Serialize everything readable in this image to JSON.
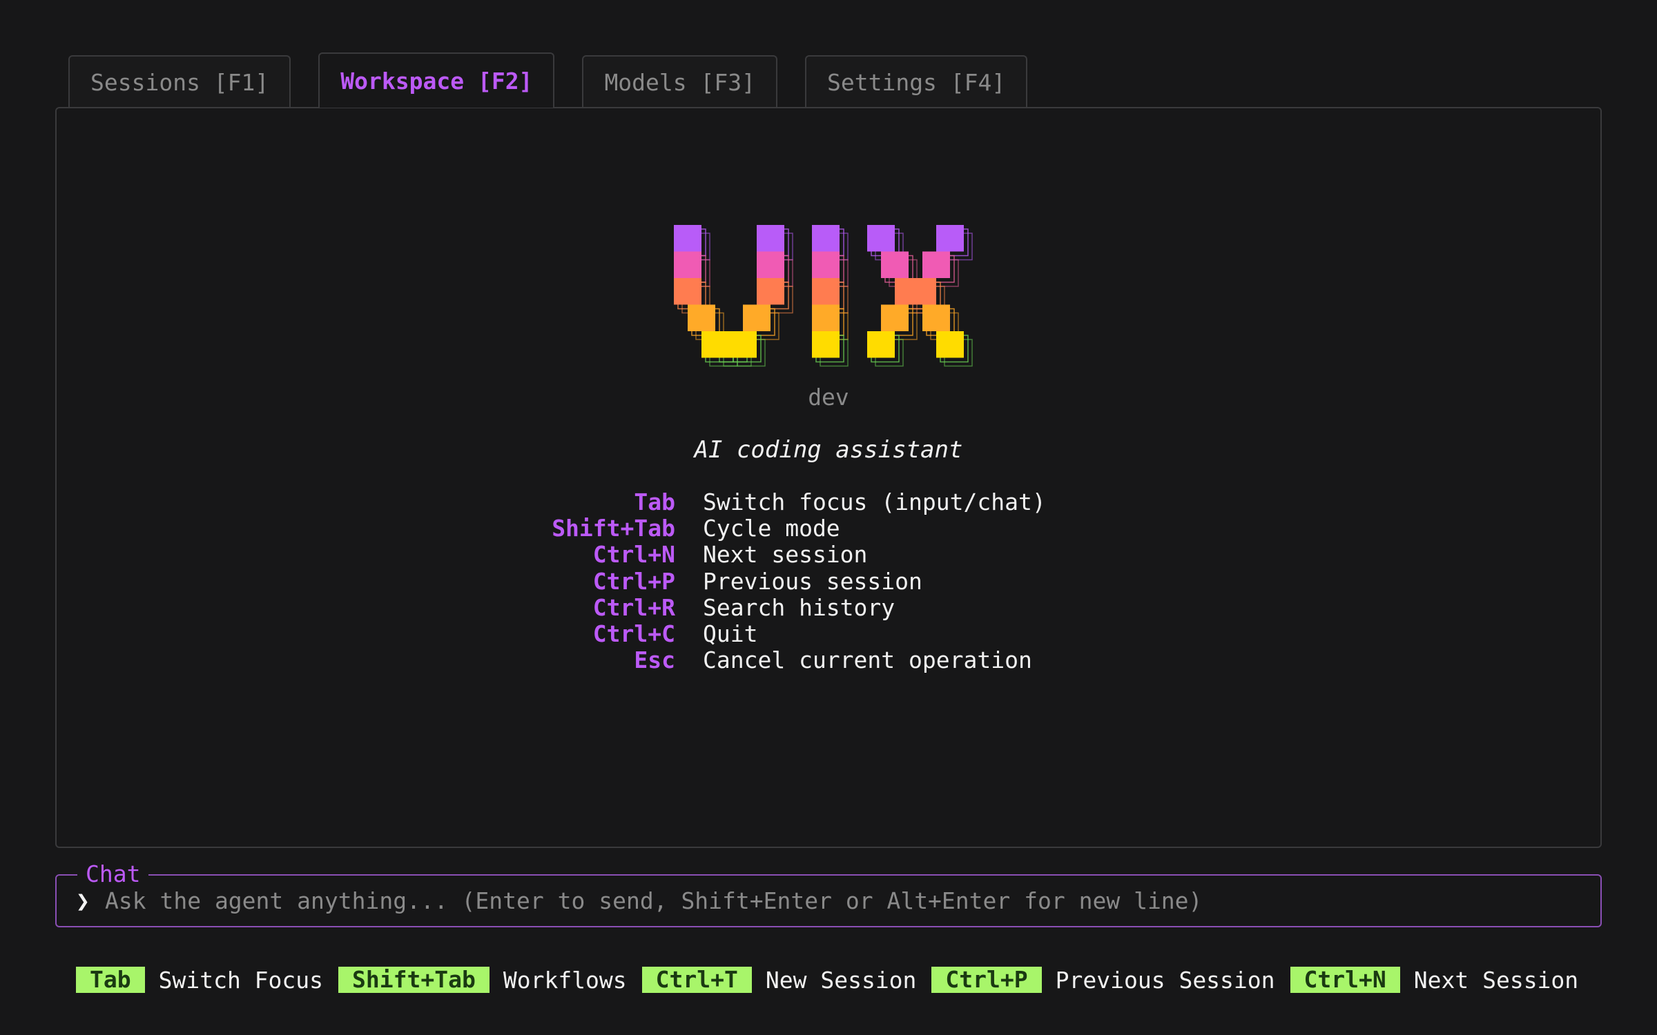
{
  "tabs": [
    {
      "label": "Sessions [F1]",
      "active": false
    },
    {
      "label": "Workspace [F2]",
      "active": true
    },
    {
      "label": "Models [F3]",
      "active": false
    },
    {
      "label": "Settings [F4]",
      "active": false
    }
  ],
  "logo": {
    "text": "VIX",
    "subtitle": "dev",
    "gradient": [
      "#b85cf8",
      "#f05bb4",
      "#ff7c50",
      "#ffaa28",
      "#ffdc00"
    ],
    "shadow_colors": [
      "#b85cf8",
      "#e8609a",
      "#ff8a4a",
      "#ffa726",
      "#6ad052"
    ]
  },
  "tagline": "AI coding assistant",
  "shortcuts": [
    {
      "key": "Tab",
      "desc": "Switch focus (input/chat)"
    },
    {
      "key": "Shift+Tab",
      "desc": "Cycle mode"
    },
    {
      "key": "Ctrl+N",
      "desc": "Next session"
    },
    {
      "key": "Ctrl+P",
      "desc": "Previous session"
    },
    {
      "key": "Ctrl+R",
      "desc": "Search history"
    },
    {
      "key": "Ctrl+C",
      "desc": "Quit"
    },
    {
      "key": "Esc",
      "desc": "Cancel current operation"
    }
  ],
  "chat": {
    "label": "Chat",
    "prompt_symbol": "❯",
    "placeholder": "Ask the agent anything... (Enter to send, Shift+Enter or Alt+Enter for new line)",
    "value": ""
  },
  "footer": [
    {
      "key": "Tab",
      "label": "Switch Focus"
    },
    {
      "key": "Shift+Tab",
      "label": "Workflows"
    },
    {
      "key": "Ctrl+T",
      "label": "New Session"
    },
    {
      "key": "Ctrl+P",
      "label": "Previous Session"
    },
    {
      "key": "Ctrl+N",
      "label": "Next Session"
    }
  ],
  "colors": {
    "accent": "#bc5af7",
    "footer_key_bg": "#a8f56a",
    "border": "#3a3a3c",
    "background": "#171718"
  }
}
